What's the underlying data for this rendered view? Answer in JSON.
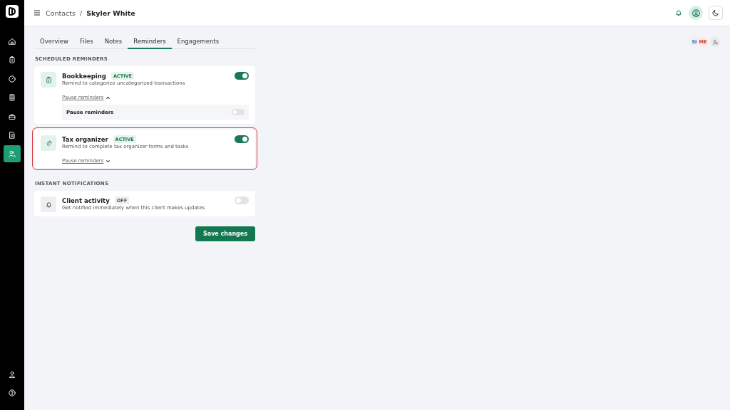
{
  "breadcrumb": {
    "parent": "Contacts",
    "separator": "/",
    "current": "Skyler White"
  },
  "sidebar": {
    "items": [
      {
        "selected": false
      },
      {
        "selected": false
      },
      {
        "selected": false
      },
      {
        "selected": false
      },
      {
        "selected": false
      },
      {
        "selected": false
      },
      {
        "selected": true
      }
    ]
  },
  "tabs": [
    {
      "label": "Overview",
      "selected": false
    },
    {
      "label": "Files",
      "selected": false
    },
    {
      "label": "Notes",
      "selected": false
    },
    {
      "label": "Reminders",
      "selected": true
    },
    {
      "label": "Engagements",
      "selected": false
    }
  ],
  "avatars": [
    "SI",
    "ME"
  ],
  "sections": [
    {
      "title": "SCHEDULED REMINDERS",
      "cards": [
        {
          "title": "Bookkeeping",
          "badge": "ACTIVE",
          "on": true,
          "description": "Remind to categorize uncategorized transactions",
          "highlighted": false,
          "pause_link": "Pause reminders",
          "expanded": true,
          "pause_label": "Pause reminders",
          "pause_on": false
        },
        {
          "title": "Tax organizer",
          "badge": "ACTIVE",
          "on": true,
          "description": "Remind to complete tax organizer forms and tasks",
          "highlighted": true,
          "pause_link": "Pause reminders",
          "expanded": false
        }
      ]
    },
    {
      "title": "INSTANT NOTIFICATIONS",
      "cards": [
        {
          "title": "Client activity",
          "badge": "OFF",
          "on": false,
          "description": "Get notified immediately when this client makes updates",
          "highlighted": false
        }
      ]
    }
  ],
  "save_button": "Save changes"
}
